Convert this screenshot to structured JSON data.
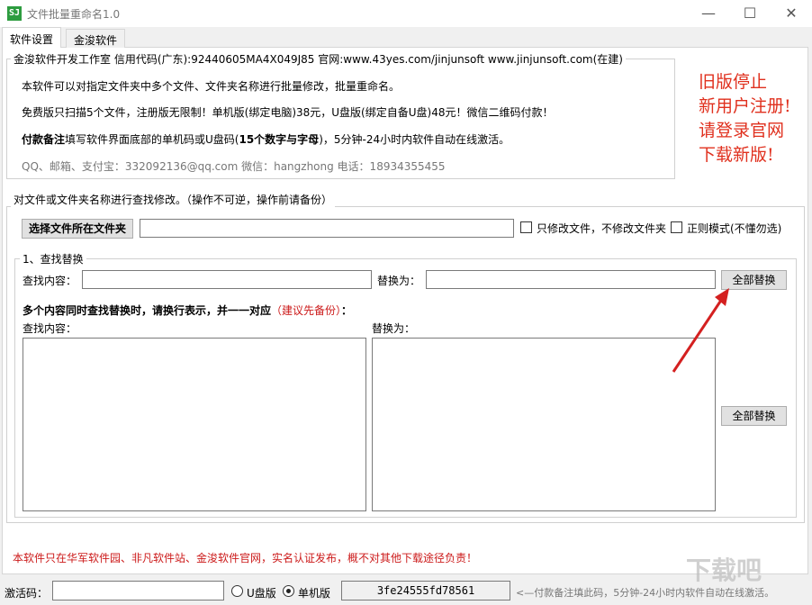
{
  "window": {
    "title": "文件批量重命名1.0",
    "icon": "SJ",
    "minimize": "—",
    "maximize": "☐",
    "close": "✕"
  },
  "tabs": [
    {
      "label": "软件设置"
    },
    {
      "label": "金浚软件"
    }
  ],
  "info_group": {
    "legend": "金浚软件开发工作室 信用代码(广东):92440605MA4X049J85 官网:www.43yes.com/jinjunsoft  www.jinjunsoft.com(在建)",
    "line1": "本软件可以对指定文件夹中多个文件、文件夹名称进行批量修改，批量重命名。",
    "line2": "免费版只扫描5个文件，注册版无限制！单机版(绑定电脑)38元，U盘版(绑定自备U盘)48元！微信二维码付款！",
    "line3_bold": "付款备注",
    "line3_mid": "填写软件界面底部的单机码或U盘码(",
    "line3_bold2": "15个数字与字母",
    "line3_end": ")，5分钟-24小时内软件自动在线激活。",
    "contact": "QQ、邮箱、支付宝：332092136@qq.com    微信：hangzhong    电话：18934355455"
  },
  "notice": "旧版停止\n新用户注册!\n请登录官网\n下载新版!",
  "rename_group": {
    "legend": "对文件或文件夹名称进行查找修改。（操作不可逆，操作前请备份）",
    "choose_folder_button": "选择文件所在文件夹",
    "folder_path": "",
    "only_files_label": "只修改文件，不修改文件夹",
    "regex_label": "正则模式(不懂勿选)"
  },
  "find_replace_group": {
    "legend": "1、查找替换",
    "find_label": "查找内容：",
    "find_value": "",
    "replace_label": "替换为：",
    "replace_value": "",
    "replace_all_button": "全部替换",
    "multi_hint": "多个内容同时查找替换时，请换行表示，并一一对应",
    "multi_hint_red": "（建议先备份）",
    "multi_hint_colon": "：",
    "multi_find_label": "查找内容：",
    "multi_replace_label": "替换为：",
    "multi_replace_all_button": "全部替换"
  },
  "footer": {
    "disclaimer": "本软件只在华军软件园、非凡软件站、金浚软件官网，实名认证发布，概不对其他下载途径负责！",
    "activation_label": "激活码：",
    "activation_value": "",
    "usb_label": "U盘版",
    "pc_label": "单机版",
    "machine_code": "3fe24555fd78561",
    "hint": "<—付款备注填此码，5分钟-24小时内软件自动在线激活。"
  },
  "watermark": "下载吧",
  "colors": {
    "notice_red": "#e0301e",
    "arrow_red": "#d42020",
    "disclaimer_red": "#cc1a1a"
  }
}
